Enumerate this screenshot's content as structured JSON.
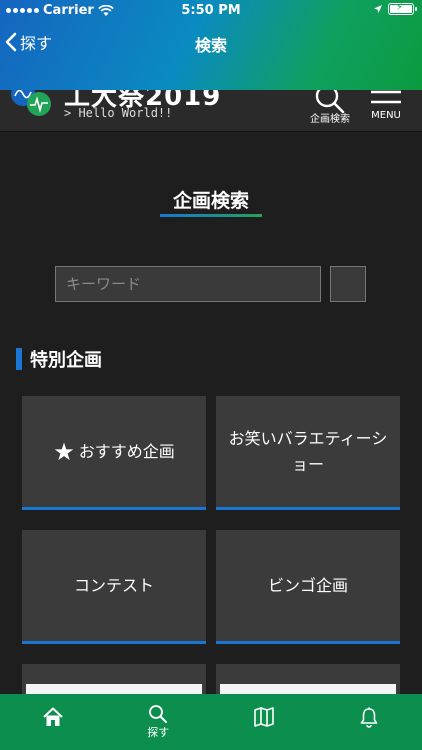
{
  "status_bar": {
    "carrier": "Carrier",
    "time": "5:50 PM"
  },
  "nav": {
    "back_label": "探す",
    "title": "検索"
  },
  "header": {
    "logo_title": "工大祭2019",
    "logo_subtitle": "> Hello World!!",
    "search_label": "企画検索",
    "menu_label": "MENU"
  },
  "main": {
    "section_title": "企画検索",
    "search_placeholder": "キーワード",
    "special_heading": "特別企画",
    "cards": [
      {
        "label": "おすすめ企画",
        "icon": "star-icon"
      },
      {
        "label": "お笑いバラエティーショー"
      },
      {
        "label": "コンテスト"
      },
      {
        "label": "ビンゴ企画"
      }
    ]
  },
  "tab_bar": {
    "tabs": [
      {
        "icon": "home-icon",
        "label": ""
      },
      {
        "icon": "search-icon",
        "label": "探す"
      },
      {
        "icon": "map-icon",
        "label": ""
      },
      {
        "icon": "bell-icon",
        "label": ""
      }
    ]
  },
  "colors": {
    "accent_blue": "#1976d2",
    "accent_green": "#0c8f4e",
    "background": "#1e1e1e",
    "card": "#3b3b3b"
  }
}
